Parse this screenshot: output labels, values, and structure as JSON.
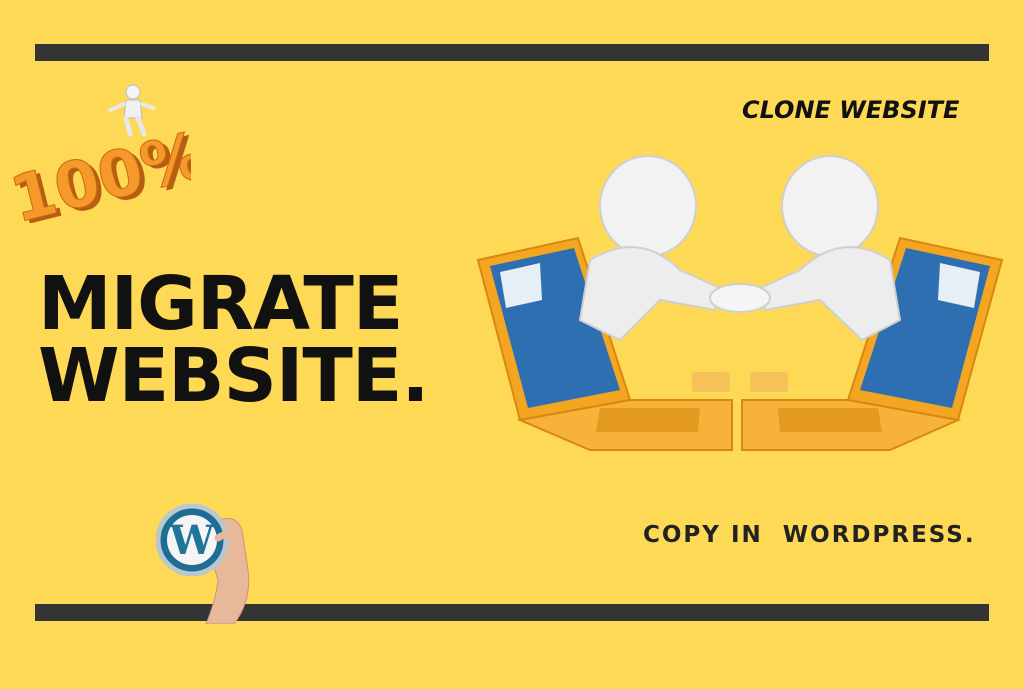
{
  "banner": {
    "headline_line1": "MIGRATE",
    "headline_line2": "WEBSITE.",
    "tagline_top": "CLONE WEBSITE",
    "tagline_bottom": "COPY IN  WORDPRESS.",
    "percent_badge": "100%",
    "wp_logo_letter": "W"
  },
  "colors": {
    "background": "#FDD955",
    "bars": "#343434",
    "laptop_orange": "#F4A622",
    "text": "#111111",
    "wp_blue": "#21759B"
  },
  "icons": [
    "100-percent-icon",
    "wordpress-logo-icon",
    "handshake-laptops-icon"
  ]
}
